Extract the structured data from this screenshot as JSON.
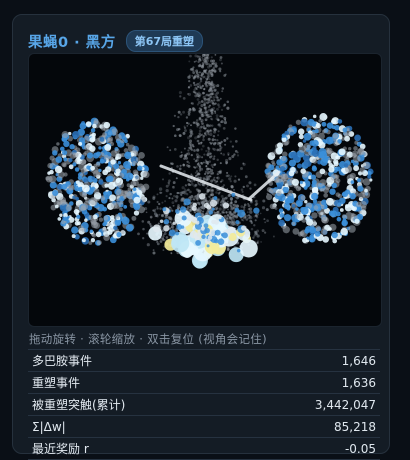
{
  "header": {
    "title": "果蝇0 · 黑方",
    "badge": "第67局重塑"
  },
  "viewport": {
    "hint": "拖动旋转 · 滚轮缩放 · 双击复位 (视角会记住)"
  },
  "colors": {
    "accent": "#58a6e8",
    "neuron_blue": "#3b8fd9",
    "neuron_yellow": "#f3ec9a",
    "neuron_white": "#e6f7ff"
  },
  "stats": [
    {
      "label": "多巴胺事件",
      "value": "1,646"
    },
    {
      "label": "重塑事件",
      "value": "1,636"
    },
    {
      "label": "被重塑突触(累计)",
      "value": "3,442,047"
    },
    {
      "label": "Σ|Δw|",
      "value": "85,218"
    },
    {
      "label": "最近奖励 r",
      "value": "-0.05"
    }
  ]
}
